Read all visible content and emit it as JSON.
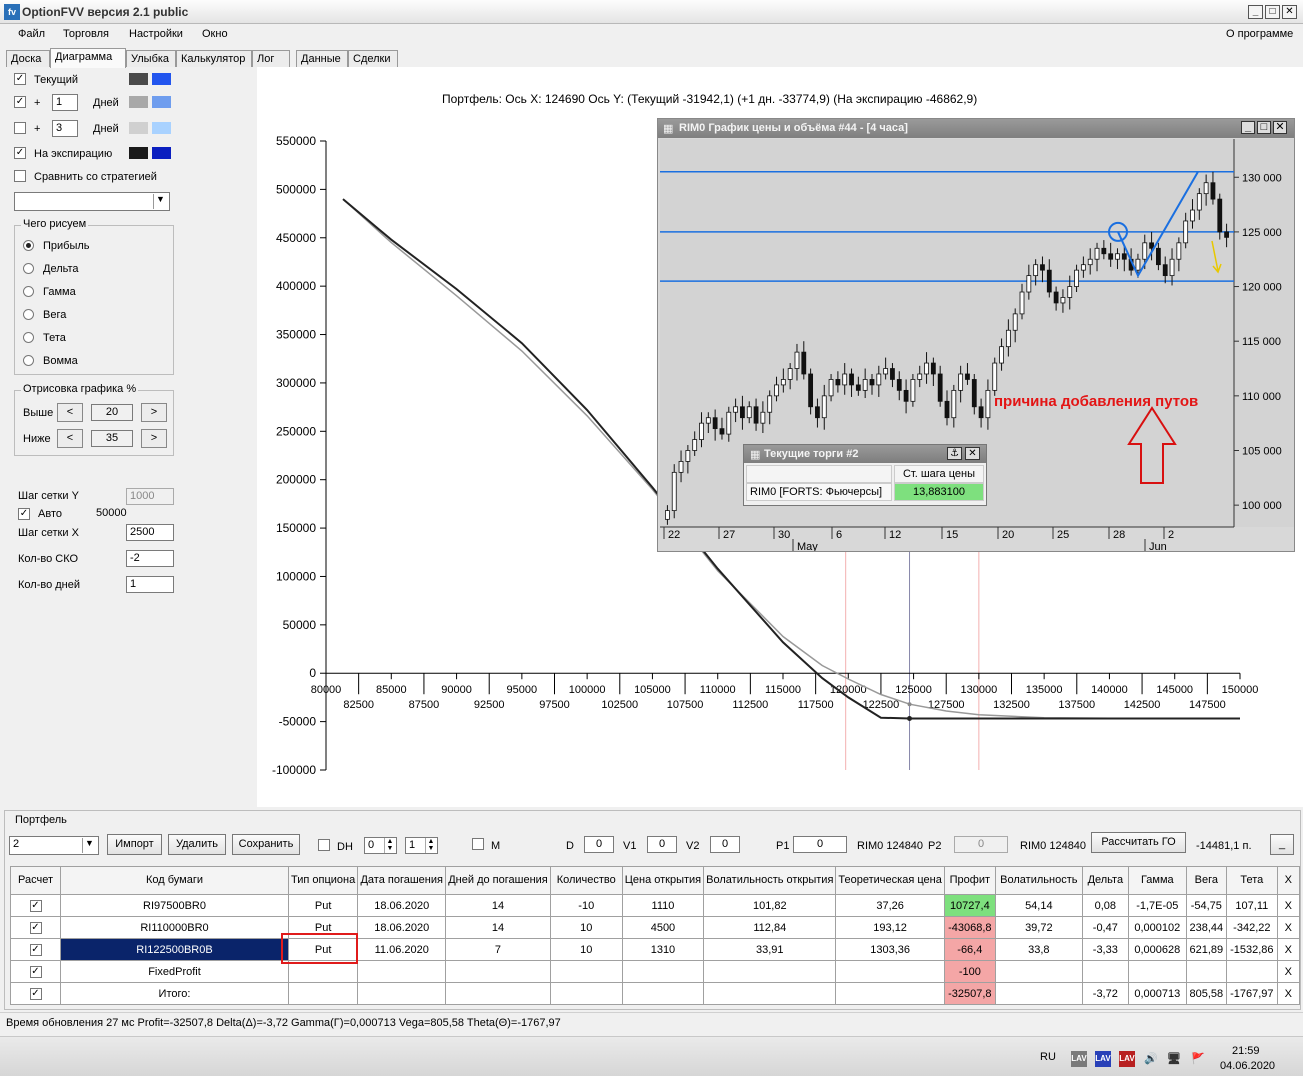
{
  "window": {
    "title": "OptionFVV версия 2.1 public",
    "app_icon": "fv",
    "min_glyph": "_",
    "max_glyph": "□",
    "close_glyph": "✕"
  },
  "menu": {
    "items": [
      "Файл",
      "Торговля",
      "Настройки",
      "Окно"
    ],
    "about": "О программе"
  },
  "tabs": [
    "Доска",
    "Диаграмма",
    "Улыбка",
    "Калькулятор",
    "Лог",
    "Данные",
    "Сделки"
  ],
  "left": {
    "current_label": "Текущий",
    "plus": "+",
    "plus1_value": "1",
    "plus2_value": "3",
    "days_label": "Дней",
    "expiry_label": "На экспирацию",
    "compare_label": "Сравнить со стратегией",
    "what_title": "Чего рисуем",
    "what_options": [
      "Прибыль",
      "Дельта",
      "Гамма",
      "Вега",
      "Тета",
      "Вомма"
    ],
    "draw_title": "Отрисовка графика %",
    "above_label": "Выше",
    "above_value": "20",
    "below_label": "Ниже",
    "below_value": "35",
    "left_arrow": "<",
    "right_arrow": ">",
    "grid_y_label": "Шаг сетки Y",
    "grid_y_value": "1000",
    "auto_label": "Авто",
    "auto_value": "50000",
    "grid_x_label": "Шаг сетки X",
    "grid_x_value": "2500",
    "sko_label": "Кол-во СКО",
    "sko_value": "-2",
    "days_count_label": "Кол-во дней",
    "days_count_value": "1",
    "colors": {
      "current_a": "#4a4a4a",
      "current_b": "#2255ee",
      "plus1_a": "#a8a8a8",
      "plus1_b": "#6f9dee",
      "plus2_a": "#d0d0d0",
      "plus2_b": "#a9d2ff",
      "expiry_a": "#1a1a1a",
      "expiry_b": "#0b1fc0"
    }
  },
  "chart_header": "Портфель:  Ось X:  124690  Ось Y:   (Текущий -31942,1)  (+1 дн. -33774,9)  (На экспирацию -46862,9)",
  "chart_data": [
    {
      "type": "line",
      "title": "",
      "xlabel": "",
      "ylabel": "",
      "xlim": [
        80000,
        150000
      ],
      "ylim": [
        -100000,
        550000
      ],
      "x_ticks_top": [
        "80000",
        "85000",
        "90000",
        "95000",
        "100000",
        "105000",
        "110000",
        "115000",
        "120000",
        "125000",
        "130000",
        "135000",
        "140000",
        "145000",
        "150000"
      ],
      "x_ticks_bottom": [
        "82500",
        "87500",
        "92500",
        "97500",
        "102500",
        "107500",
        "112500",
        "117500",
        "122500",
        "127500",
        "132500",
        "137500",
        "142500",
        "147500"
      ],
      "y_ticks": [
        "550000",
        "500000",
        "450000",
        "400000",
        "350000",
        "300000",
        "250000",
        "200000",
        "150000",
        "100000",
        "50000",
        "0",
        "-50000",
        "-100000"
      ],
      "series": [
        {
          "color": "#222222",
          "x": [
            81300,
            85000,
            90000,
            95000,
            100000,
            105000,
            110000,
            115000,
            118000,
            120000,
            122500,
            124700,
            130000,
            140000,
            150000
          ],
          "y": [
            490000,
            448000,
            397000,
            341000,
            272000,
            192000,
            108000,
            32000,
            -5000,
            -25000,
            -46000,
            -46800,
            -46800,
            -46800,
            -46800
          ]
        },
        {
          "color": "#999999",
          "x": [
            81300,
            85000,
            90000,
            95000,
            100000,
            105000,
            110000,
            115000,
            118000,
            120000,
            122500,
            124700,
            127500,
            130000,
            135000,
            140000,
            150000
          ],
          "y": [
            490000,
            445000,
            390000,
            333000,
            266000,
            190000,
            106000,
            38000,
            8000,
            -6000,
            -22000,
            -32000,
            -39000,
            -43000,
            -46000,
            -46600,
            -46800
          ]
        }
      ],
      "vertical_lines": [
        {
          "x": 119800,
          "color": "#f3b0b0"
        },
        {
          "x": 124690,
          "color": "#8888aa"
        },
        {
          "x": 130000,
          "color": "#f3b0b0"
        }
      ]
    },
    {
      "type": "candlestick",
      "title": "RIM0 График цены и объёма #44 - [4 часа]",
      "x_ticks": [
        "22",
        "27",
        "30",
        "6",
        "12",
        "15",
        "20",
        "25",
        "28",
        "2"
      ],
      "month_labels": [
        "May",
        "Jun"
      ],
      "y_ticks": [
        "130 000",
        "125 000",
        "120 000",
        "115 000",
        "110 000",
        "105 000",
        "100 000"
      ],
      "ylim": [
        98000,
        133500
      ],
      "horizontal_levels": [
        130500,
        125000,
        120500
      ],
      "close": [
        99500,
        103000,
        104000,
        105000,
        106000,
        107500,
        108000,
        107000,
        106500,
        108500,
        109000,
        108000,
        109000,
        107500,
        108500,
        110000,
        111000,
        111500,
        112500,
        114000,
        112000,
        109000,
        108000,
        110000,
        111500,
        111000,
        112000,
        111000,
        110500,
        111500,
        111000,
        112000,
        112500,
        111500,
        110500,
        109500,
        111500,
        112000,
        113000,
        112000,
        109500,
        108000,
        110500,
        112000,
        111500,
        109000,
        108000,
        110500,
        113000,
        114500,
        116000,
        117500,
        119500,
        121000,
        122000,
        121500,
        119500,
        118500,
        119000,
        120000,
        121500,
        122000,
        122500,
        123500,
        123000,
        122500,
        123000,
        122500,
        121500,
        122500,
        124000,
        123500,
        122000,
        121000,
        122500,
        124000,
        126000,
        127000,
        128500,
        129500,
        128000,
        125000,
        124500
      ]
    }
  ],
  "inner_chart": {
    "win_icon": "▦",
    "annotation": "причина добавления путов",
    "annotation_color": "#e31515",
    "arrow_color": "#d81010",
    "level_color": "#1a6fe0"
  },
  "trades_popup": {
    "title": "Текущие торги #2",
    "pin_glyph": "⚓",
    "close_glyph": "✕",
    "col_header": "Ст. шага цены",
    "row_label": "RIM0 [FORTS: Фьючерсы]",
    "row_value": "13,883100"
  },
  "portfolio": {
    "title": "Портфель",
    "selected": "2",
    "import_label": "Импорт",
    "delete_label": "Удалить",
    "save_label": "Сохранить",
    "dh_label": "DH",
    "dh_v1": "0",
    "dh_v2": "1",
    "m_label": "M",
    "d_label": "D",
    "d_value": "0",
    "v1_label": "V1",
    "v1_value": "0",
    "v2_label": "V2",
    "v2_value": "0",
    "p1_label": "P1",
    "p1_value": "0",
    "rim_p1": "RIM0 124840",
    "p2_label": "P2",
    "p2_value": "0",
    "rim_p2": "RIM0 124840",
    "calc_label": "Рассчитать ГО",
    "go_value": "-14481,1 п.",
    "minimize_glyph": "_",
    "columns": [
      "Расчет",
      "Код бумаги",
      "Тип опциона",
      "Дата погашения",
      "Дней до погашения",
      "Количество",
      "Цена открытия",
      "Волатильность открытия",
      "Теоретическая цена",
      "Профит",
      "Волатильность",
      "Дельта",
      "Гамма",
      "Вега",
      "Тета",
      "X"
    ],
    "rows": [
      [
        "RI97500BR0",
        "Put",
        "18.06.2020",
        "14",
        "-10",
        "1110",
        "101,82",
        "37,26",
        "10727,4",
        "54,14",
        "0,08",
        "-1,7E-05",
        "-54,75",
        "107,11",
        "X"
      ],
      [
        "RI110000BR0",
        "Put",
        "18.06.2020",
        "14",
        "10",
        "4500",
        "112,84",
        "193,12",
        "-43068,8",
        "39,72",
        "-0,47",
        "0,000102",
        "238,44",
        "-342,22",
        "X"
      ],
      [
        "RI122500BR0B",
        "Put",
        "11.06.2020",
        "7",
        "10",
        "1310",
        "33,91",
        "1303,36",
        "-66,4",
        "33,8",
        "-3,33",
        "0,000628",
        "621,89",
        "-1532,86",
        "X"
      ],
      [
        "FixedProfit",
        "",
        "",
        "",
        "",
        "",
        "",
        "",
        "-100",
        "",
        "",
        "",
        "",
        "",
        "X"
      ],
      [
        "Итого:",
        "",
        "",
        "",
        "",
        "",
        "",
        "",
        "-32507,8",
        "",
        "-3,72",
        "0,000713",
        "805,58",
        "-1767,97",
        "X"
      ]
    ],
    "profit_pos_color": "#7ee07e",
    "profit_neg_color": "#f4a6a6",
    "selected_row_color": "#0a246a",
    "highlight_color": "#e01b1b"
  },
  "status": "Время обновления 27 мс  Profit=-32507,8 Delta(Δ)=-3,72 Gamma(Γ)=0,000713 Vega=805,58 Theta(Θ)=-1767,97",
  "taskbar": {
    "lang": "RU",
    "time": "21:59",
    "date": "04.06.2020",
    "tray_icons": [
      "LAV",
      "LAV",
      "LAV",
      "🔊",
      "🖥",
      "🚩"
    ]
  }
}
